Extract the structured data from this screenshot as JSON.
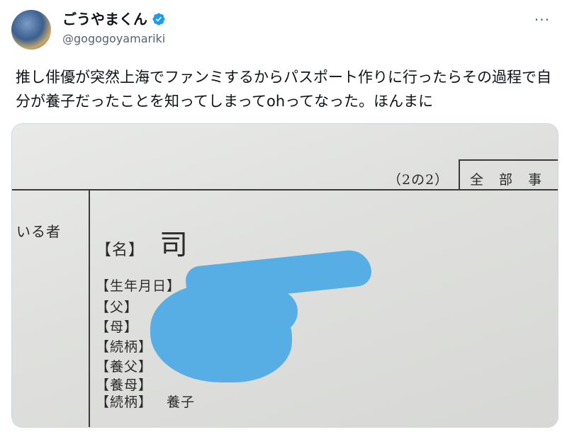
{
  "user": {
    "display_name": "ごうやまくん",
    "handle": "@gogogoyamariki",
    "verified_icon": "verified-badge-icon"
  },
  "more_label": "···",
  "tweet": {
    "text": "推し俳優が突然上海でファンミするからパスポート作りに行ったらその過程で自分が養子だったことを知ってしまってohってなった。ほんまに"
  },
  "photo": {
    "page_marker": "（2の2）",
    "header_label": "全 部 事",
    "left_column_text": "いる者",
    "name_label": "【名】",
    "name_value": "司",
    "birthdate_label": "【生年月日】",
    "father_label": "【父】",
    "mother_label": "【母】",
    "relation_label_1": "【続柄】",
    "adoptive_father_label": "【養父】",
    "adoptive_mother_label": "【養母】",
    "relation_label_2": "【続柄】",
    "relation_value_2": "養子"
  }
}
